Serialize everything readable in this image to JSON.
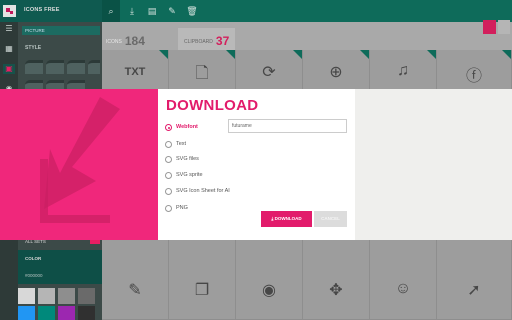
{
  "app": {
    "title": "ICONS FREE"
  },
  "sidebar": {
    "filter_label": "PICTURE",
    "style_label": "STYLE",
    "allsets_label": "ALL SETS",
    "color_label": "COLOR",
    "color_value": "#000000",
    "accent": "#e91e63",
    "swatches": [
      "#d8d8d8",
      "#b5b5b5",
      "#8e8e8e",
      "#6a6a6a",
      "#2196f3",
      "#00897b",
      "#9c27b0",
      "#303030"
    ]
  },
  "toolbar": {
    "icons": [
      "search-icon",
      "download-icon",
      "export-icon",
      "edit-icon",
      "trash-icon"
    ]
  },
  "tabs": [
    {
      "label": "ICONS",
      "count": "184"
    },
    {
      "label": "CLIPBOARD",
      "count": "37"
    }
  ],
  "grid": {
    "row1": [
      "txt-file-icon",
      "file-icon",
      "refresh-icon",
      "add-circle-icon",
      "music-note-icon",
      "facebook-icon"
    ],
    "row3": [
      "pencil-icon",
      "windows-icon",
      "eye-icon",
      "move-icon",
      "smiley-icon",
      "cursor-icon"
    ]
  },
  "modal": {
    "title": "DOWNLOAD",
    "options": [
      {
        "label": "Webfont",
        "selected": true
      },
      {
        "label": "Text",
        "selected": false
      },
      {
        "label": "SVG files",
        "selected": false
      },
      {
        "label": "SVG sprite",
        "selected": false
      },
      {
        "label": "SVG Icon Sheet for AI",
        "selected": false
      },
      {
        "label": "PNG",
        "selected": false
      }
    ],
    "font_name_value": "futurame",
    "download_label": "DOWNLOAD",
    "cancel_label": "CANCEL"
  }
}
